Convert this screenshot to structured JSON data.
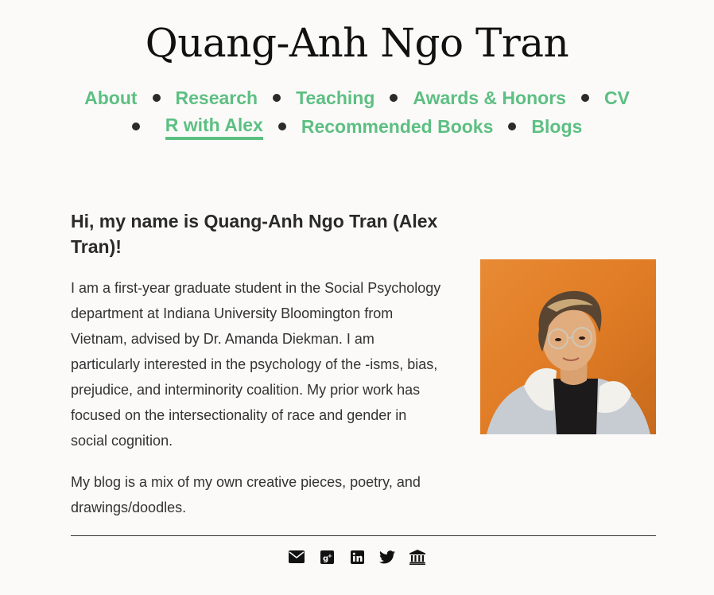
{
  "site": {
    "title": "Quang-Anh Ngo Tran"
  },
  "nav": {
    "row1": [
      "About",
      "Research",
      "Teaching",
      "Awards & Honors",
      "CV"
    ],
    "row2": [
      "R with Alex",
      "Recommended Books",
      "Blogs"
    ],
    "active": "R with Alex",
    "link_color": "#5dbf82"
  },
  "main": {
    "heading": "Hi, my name is Quang-Anh Ngo Tran (Alex Tran)!",
    "paragraph1": "I am a first-year graduate student in the Social Psychology department at Indiana University Bloomington from Vietnam, advised by Dr. Amanda Diekman. I am particularly interested in the psychology of the -isms, bias, prejudice, and interminority coalition. My prior work has focused on the intersectionality of race and gender in social cognition.",
    "paragraph2": "My blog is a mix of my own creative pieces, poetry, and drawings/doodles."
  },
  "footer": {
    "icons": [
      "envelope-icon",
      "google-plus-icon",
      "linkedin-icon",
      "twitter-icon",
      "bank-icon"
    ]
  }
}
